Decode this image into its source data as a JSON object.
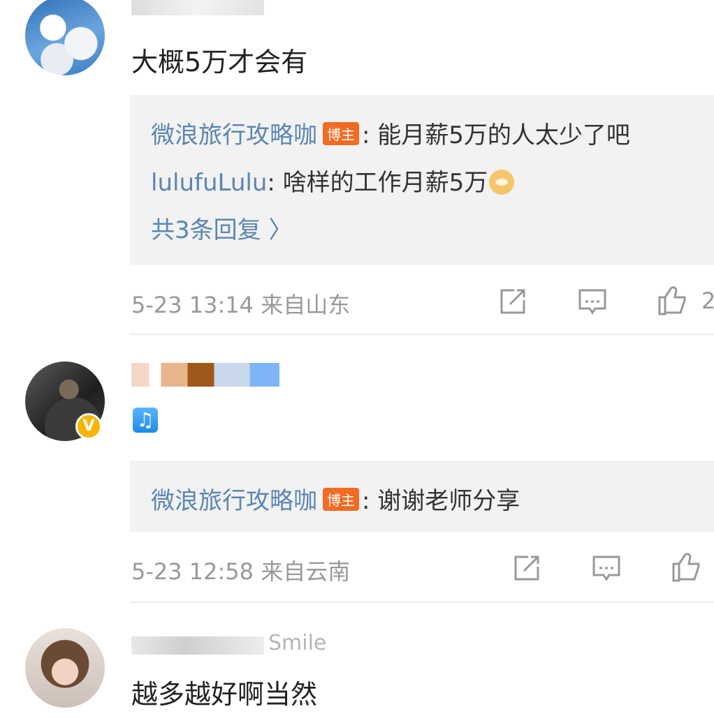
{
  "comments": [
    {
      "body": "大概5万才会有",
      "replies": [
        {
          "user": "微浪旅行攻略咖",
          "tag": "博主",
          "text": ": 能月薪5万的人太少了吧"
        },
        {
          "user": "lulufuLulu",
          "text": ": 啥样的工作月薪5万"
        }
      ],
      "more": "共3条回复 〉",
      "time": "5-23 13:14",
      "location": "来自山东",
      "likes": "2"
    },
    {
      "replies": [
        {
          "user": "微浪旅行攻略咖",
          "tag": "博主",
          "text": ": 谢谢老师分享"
        }
      ],
      "time": "5-23 12:58",
      "location": "来自云南",
      "badge": "V"
    },
    {
      "username_partial": "Smile",
      "body": "越多越好啊当然"
    }
  ],
  "icons": [
    "share-icon",
    "comment-icon",
    "like-icon",
    "music-note-icon",
    "doge-emoji-icon"
  ],
  "colors": {
    "link": "#5b86b4",
    "tag": "#f26b22",
    "meta": "#999999",
    "reply_bg": "#f2f2f2",
    "verified": "#f7b500"
  }
}
